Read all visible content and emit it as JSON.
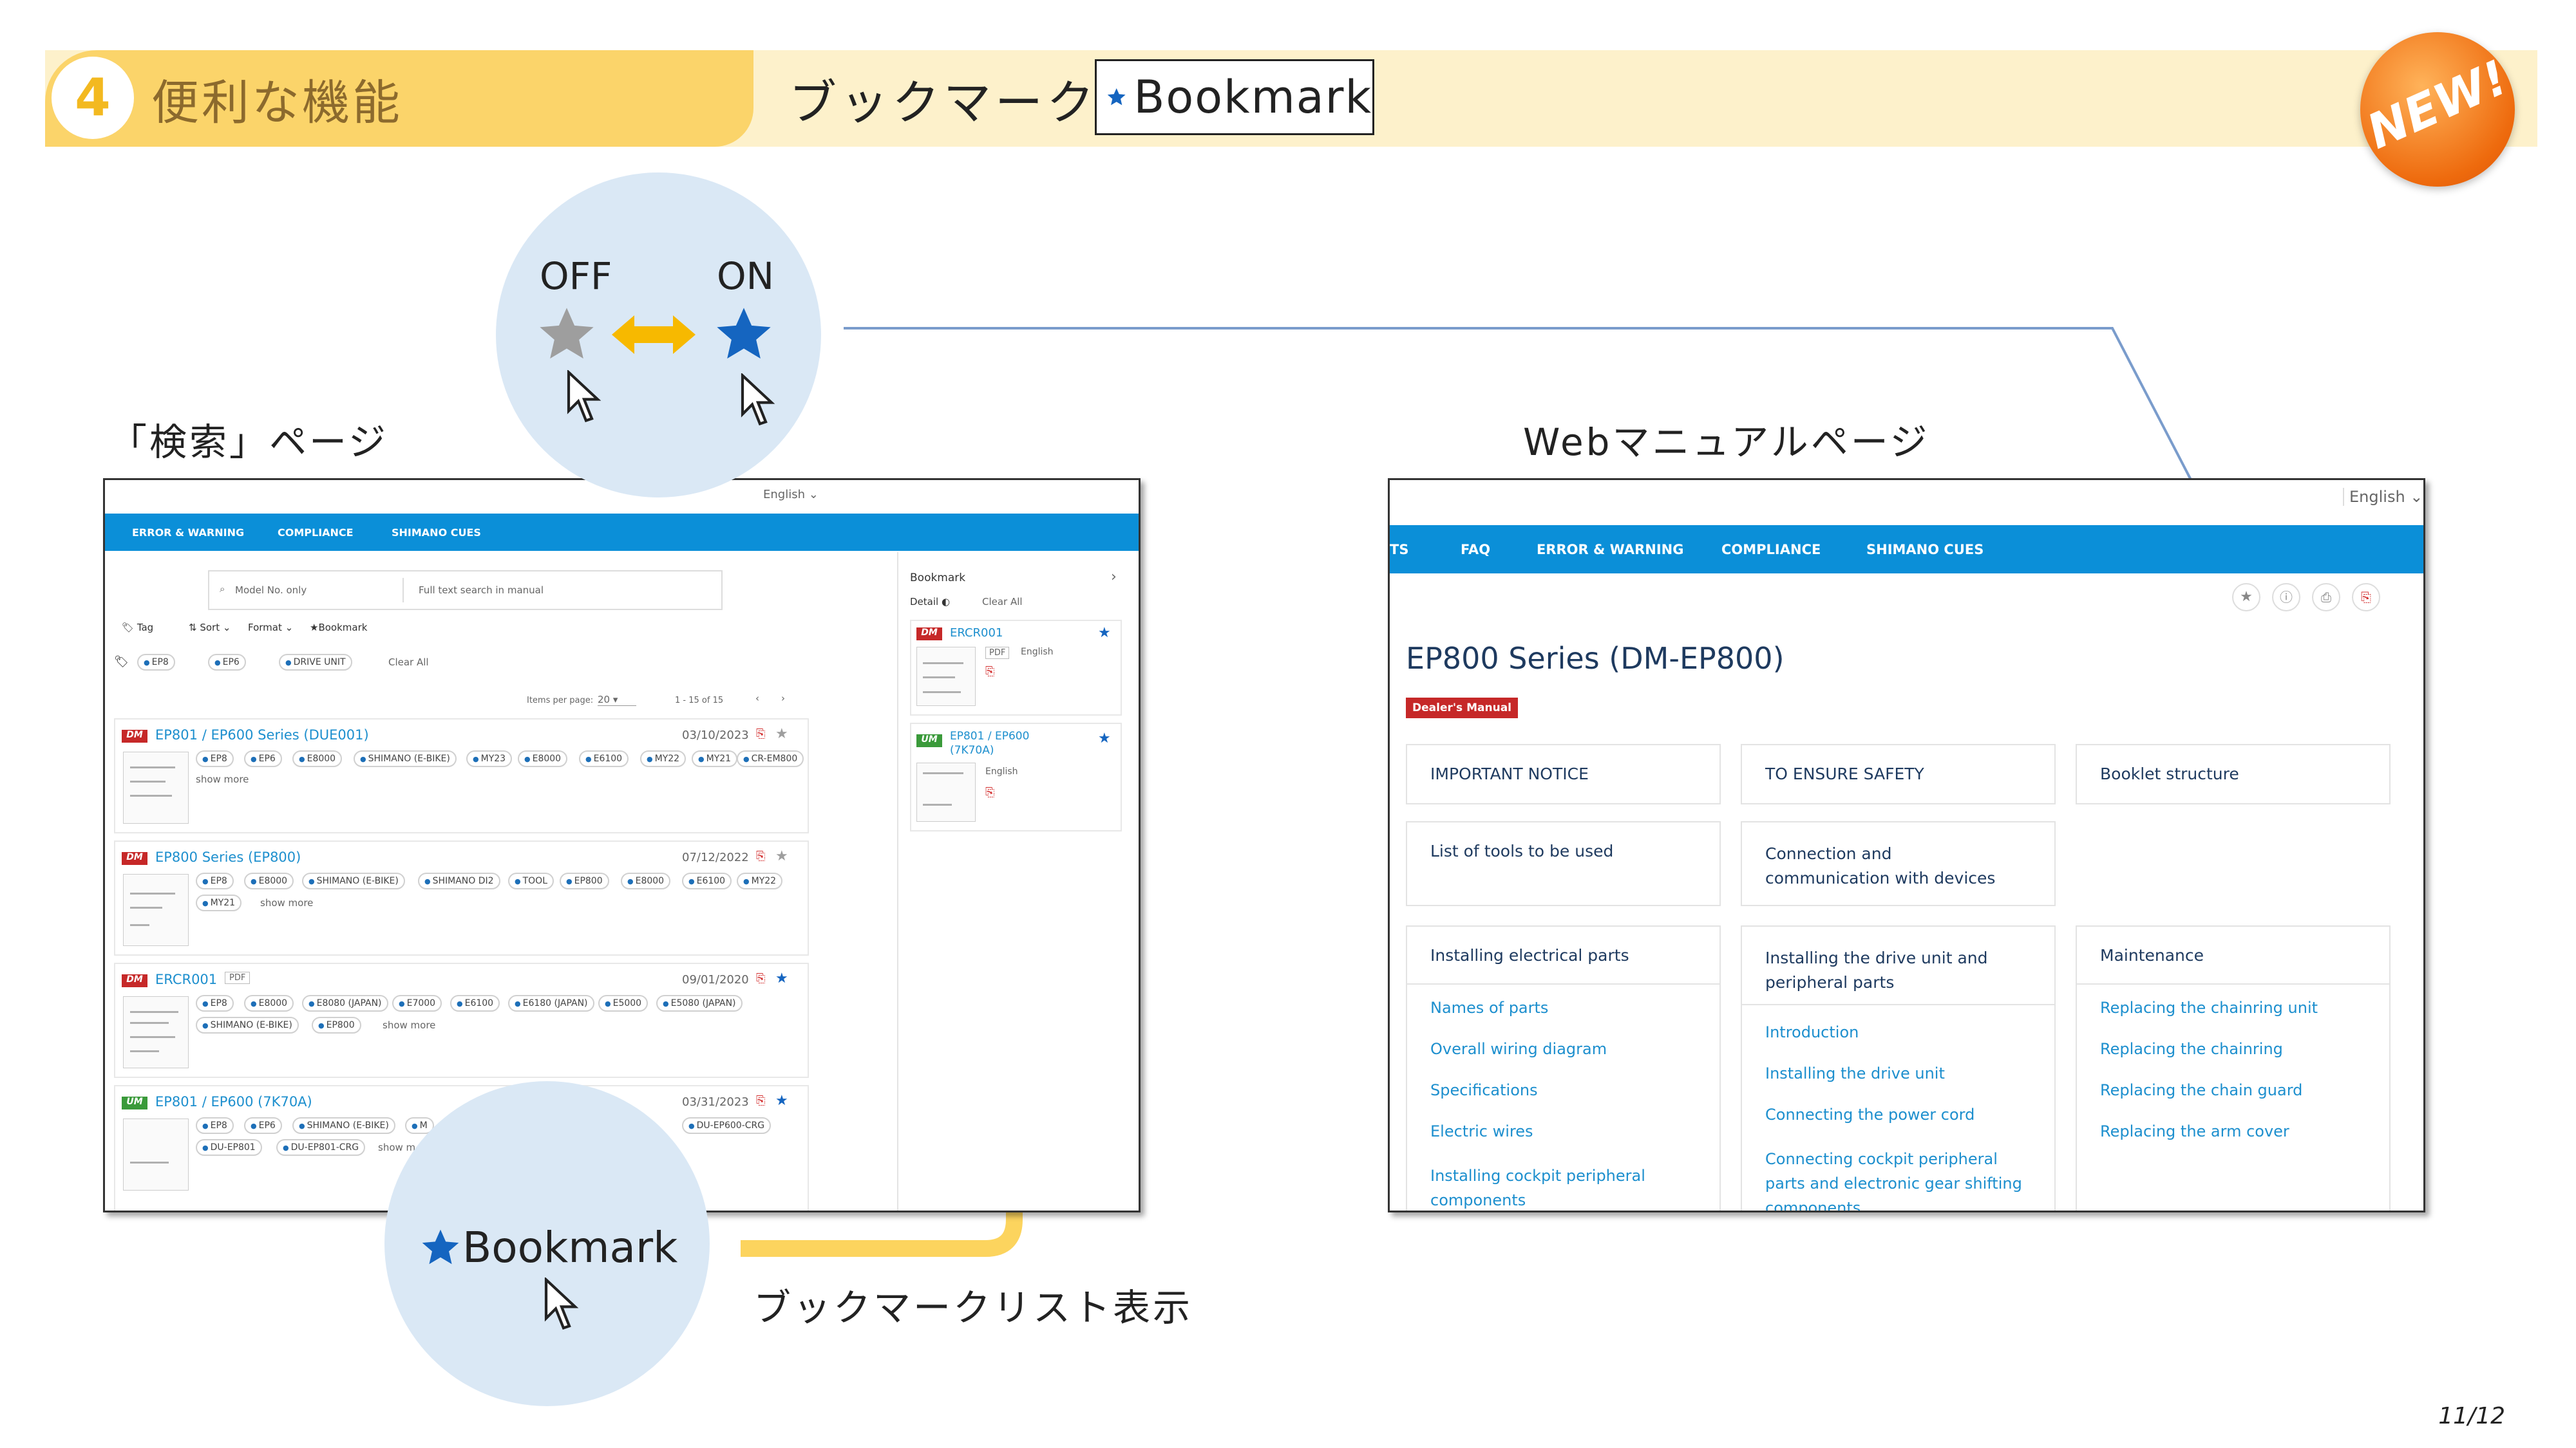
{
  "header": {
    "number": "4",
    "title": "便利な機能",
    "heading": "ブックマーク",
    "box_label": "Bookmark",
    "new_badge": "NEW!"
  },
  "toggle": {
    "off_label": "OFF",
    "on_label": "ON"
  },
  "labels": {
    "search_page": "「検索」ページ",
    "web_manual_page": "Webマニュアルページ",
    "bookmark_list": "ブックマークリスト表示",
    "bookmark_circle": "Bookmark"
  },
  "page_number": "11/12",
  "colors": {
    "accent_blue": "#0b8fd8",
    "star_blue": "#1565c0",
    "yellow": "#fbd46a",
    "dm_red": "#c62828",
    "um_green": "#3a9a3a"
  },
  "search_screen": {
    "language": "English",
    "nav": [
      "ERROR & WARNING",
      "COMPLIANCE",
      "SHIMANO CUES"
    ],
    "model_placeholder": "Model No. only",
    "fulltext_placeholder": "Full text search in manual",
    "filters": [
      "Tag",
      "Sort",
      "Format",
      "Bookmark"
    ],
    "active_tags": [
      "EP8",
      "EP6",
      "DRIVE UNIT"
    ],
    "clear_all": "Clear All",
    "items_per_page_label": "Items per page:",
    "items_per_page": "20",
    "range": "1 - 15 of 15",
    "results": [
      {
        "badge": "DM",
        "title": "EP801 / EP600 Series (DUE001)",
        "date": "03/10/2023",
        "bookmarked": false,
        "tags": [
          "EP8",
          "EP6",
          "E8000",
          "SHIMANO (E-BIKE)",
          "MY23",
          "E8000",
          "E6100",
          "MY22",
          "MY21",
          "CR-EM800"
        ],
        "more": "show more"
      },
      {
        "badge": "DM",
        "title": "EP800 Series (EP800)",
        "date": "07/12/2022",
        "bookmarked": false,
        "tags": [
          "EP8",
          "E8000",
          "SHIMANO (E-BIKE)",
          "SHIMANO DI2",
          "TOOL",
          "EP800",
          "E8000",
          "E6100",
          "MY22",
          "MY21"
        ],
        "more": "show more"
      },
      {
        "badge": "DM",
        "title": "ERCR001",
        "format": "PDF",
        "date": "09/01/2020",
        "bookmarked": true,
        "tags": [
          "EP8",
          "E8000",
          "E8080 (JAPAN)",
          "E7000",
          "E6100",
          "E6180 (JAPAN)",
          "E5000",
          "E5080 (JAPAN)",
          "SHIMANO (E-BIKE)",
          "EP800"
        ],
        "more": "show more"
      },
      {
        "badge": "UM",
        "title": "EP801 / EP600 (7K70A)",
        "date": "03/31/2023",
        "bookmarked": true,
        "tags": [
          "EP8",
          "EP6",
          "SHIMANO (E-BIKE)",
          "M",
          "DU-EP600-CRG",
          "DU-EP801",
          "DU-EP801-CRG"
        ],
        "more": "show m"
      }
    ],
    "sidebar": {
      "title": "Bookmark",
      "detail": "Detail",
      "clear_all": "Clear All",
      "items": [
        {
          "badge": "DM",
          "title": "ERCR001",
          "format": "PDF",
          "lang": "English"
        },
        {
          "badge": "UM",
          "title": "EP801 / EP600 (7K70A)",
          "lang": "English"
        }
      ]
    }
  },
  "manual_screen": {
    "language": "English",
    "nav": [
      "TS",
      "FAQ",
      "ERROR & WARNING",
      "COMPLIANCE",
      "SHIMANO CUES"
    ],
    "title": "EP800 Series (DM-EP800)",
    "badge": "Dealer's Manual",
    "tiles_row1": [
      "IMPORTANT NOTICE",
      "TO ENSURE SAFETY",
      "Booklet structure"
    ],
    "tiles_row2": [
      "List of tools to be used",
      "Connection and communication with devices"
    ],
    "col1": {
      "title": "Installing electrical parts",
      "links": [
        "Names of parts",
        "Overall wiring diagram",
        "Specifications",
        "Electric wires",
        "Installing cockpit peripheral components"
      ]
    },
    "col2": {
      "title": "Installing the drive unit and peripheral parts",
      "links": [
        "Introduction",
        "Installing the drive unit",
        "Connecting the power cord",
        "Connecting cockpit peripheral parts and electronic gear shifting components"
      ]
    },
    "col3": {
      "title": "Maintenance",
      "links": [
        "Replacing the chainring unit",
        "Replacing the chainring",
        "Replacing the chain guard",
        "Replacing the arm cover"
      ]
    }
  }
}
